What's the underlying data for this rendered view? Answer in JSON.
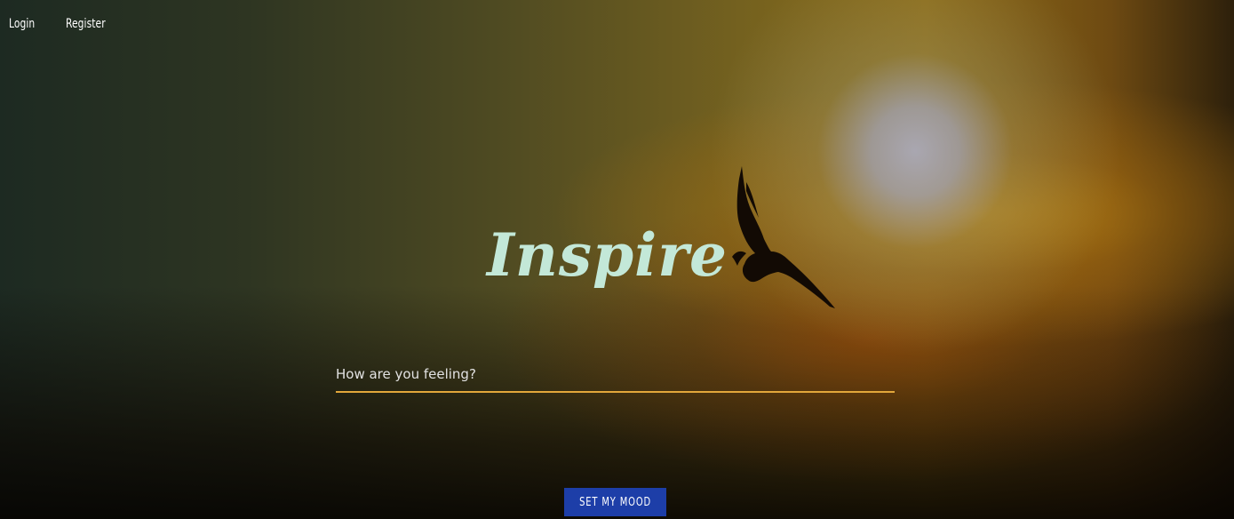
{
  "nav": {
    "login_label": "Login",
    "register_label": "Register"
  },
  "hero": {
    "brand": "Inspire",
    "icon": "bird-silhouette-icon"
  },
  "form": {
    "placeholder": "How are you feeling?",
    "value": "",
    "submit_label": "SET MY MOOD"
  },
  "colors": {
    "brand_text": "#c3e8d8",
    "input_underline": "#e2a73b",
    "button_bg": "#1d3ea8"
  }
}
